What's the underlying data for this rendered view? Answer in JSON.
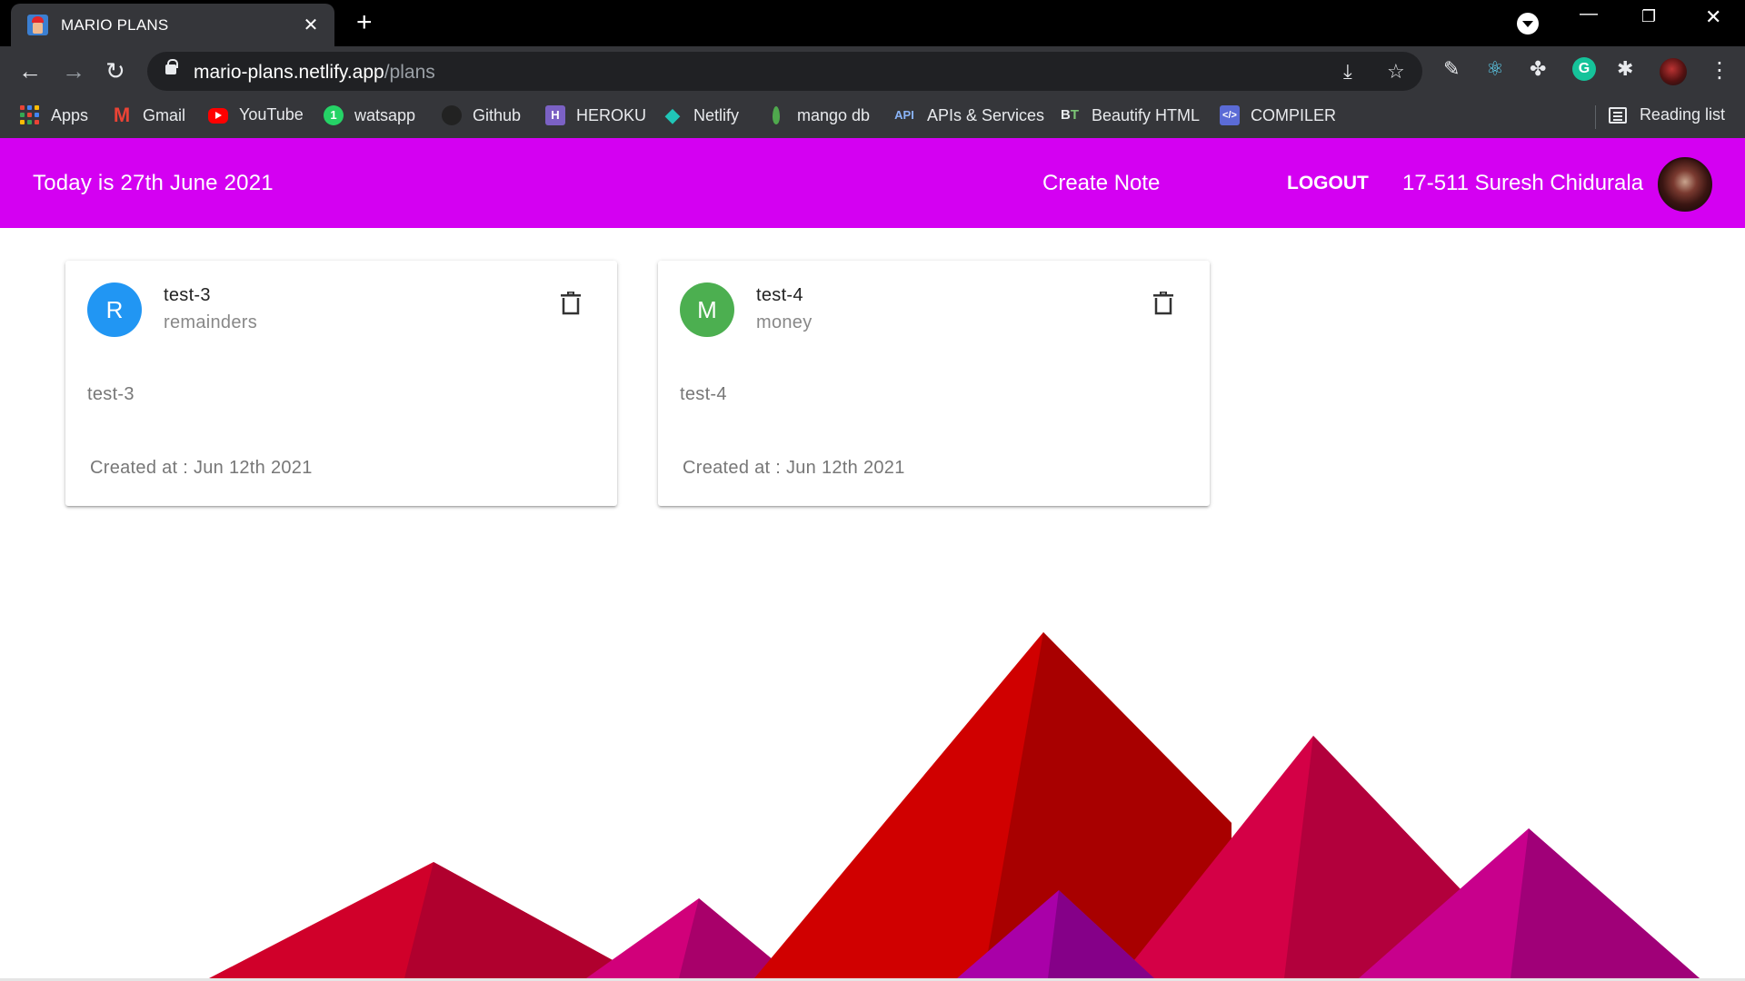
{
  "browser": {
    "tab_title": "MARIO PLANS",
    "url_host": "mario-plans.netlify.app",
    "url_path": "/plans",
    "bookmarks": [
      {
        "label": "Apps",
        "icon": "apps-grid-icon"
      },
      {
        "label": "Gmail",
        "icon": "gmail-icon"
      },
      {
        "label": "YouTube",
        "icon": "youtube-icon"
      },
      {
        "label": "watsapp",
        "icon": "whatsapp-icon"
      },
      {
        "label": "Github",
        "icon": "github-icon"
      },
      {
        "label": "HEROKU",
        "icon": "heroku-icon"
      },
      {
        "label": "Netlify",
        "icon": "netlify-icon"
      },
      {
        "label": "mango db",
        "icon": "mongodb-leaf-icon"
      },
      {
        "label": "APIs & Services",
        "icon": "api-icon"
      },
      {
        "label": "Beautify HTML",
        "icon": "beautify-icon"
      },
      {
        "label": "COMPILER",
        "icon": "compiler-icon"
      }
    ],
    "reading_list": "Reading list"
  },
  "app": {
    "today": "Today is 27th June 2021",
    "create_note": "Create Note",
    "logout": "LOGOUT",
    "username": "17-511 Suresh Chidurala",
    "accent_color": "#d400f2"
  },
  "cards": [
    {
      "initial": "R",
      "title": "test-3",
      "category": "remainders",
      "content": "test-3",
      "created": "Created at : Jun 12th 2021",
      "color": "#2196f3"
    },
    {
      "initial": "M",
      "title": "test-4",
      "category": "money",
      "content": "test-4",
      "created": "Created at : Jun 12th 2021",
      "color": "#4caf50"
    }
  ]
}
